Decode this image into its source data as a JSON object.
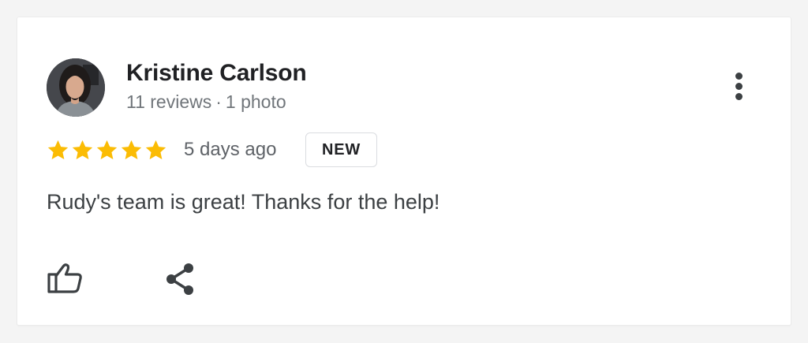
{
  "review": {
    "author_name": "Kristine Carlson",
    "reviews_count": "11 reviews",
    "separator": "·",
    "photos_count": "1 photo",
    "rating": 5,
    "rating_max": 5,
    "time_ago": "5 days ago",
    "badge": "NEW",
    "text": "Rudy's team is great! Thanks for the help!"
  },
  "icons": {
    "more": "more-vert-icon",
    "like": "thumb-up-icon",
    "share": "share-icon",
    "star": "star-icon"
  },
  "colors": {
    "star": "#fbbc04",
    "name": "#202124",
    "meta": "#70757a",
    "icon": "#3c4043",
    "badge_border": "#dadce0"
  }
}
